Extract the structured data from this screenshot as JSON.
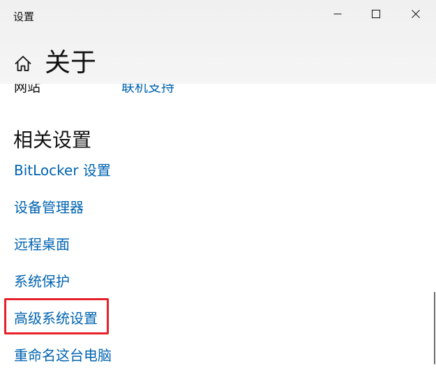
{
  "window": {
    "app_title": "设置",
    "controls": {
      "minimize": "minimize-icon",
      "maximize": "maximize-icon",
      "close": "close-icon"
    }
  },
  "header": {
    "home_icon": "home-icon",
    "page_title": "关于"
  },
  "partial_row": {
    "label": "网站",
    "link": "联机支持"
  },
  "related": {
    "heading": "相关设置",
    "links": [
      "BitLocker 设置",
      "设备管理器",
      "远程桌面",
      "系统保护",
      "高级系统设置",
      "重命名这台电脑"
    ]
  },
  "colors": {
    "link": "#0063b1",
    "highlight": "#e8202a",
    "titlebar": "#f2f2f2",
    "text": "#111111"
  }
}
